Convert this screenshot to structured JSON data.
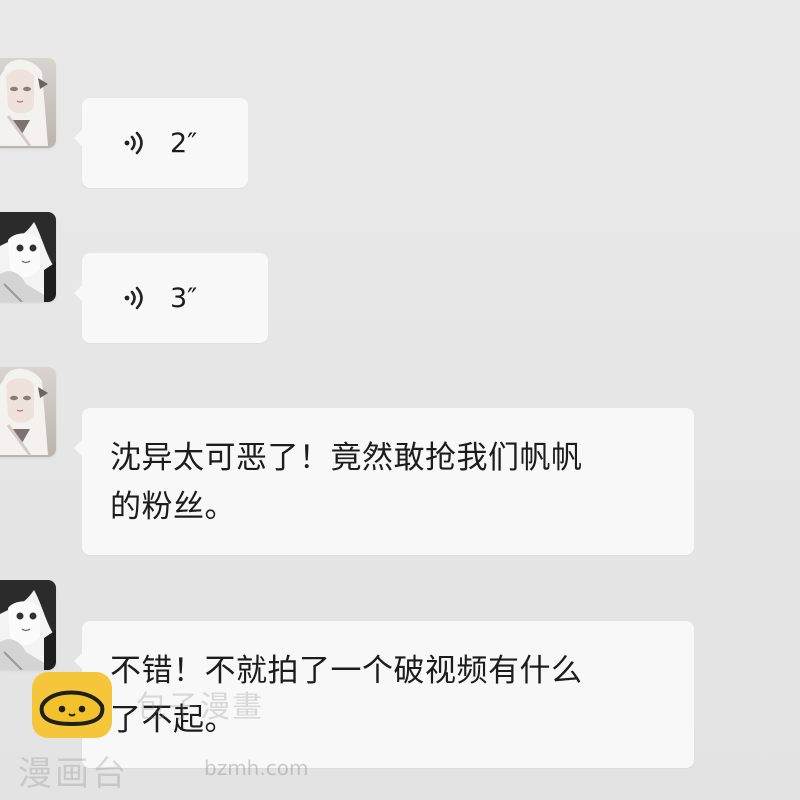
{
  "messages": [
    {
      "type": "voice",
      "avatar": "avatar-girl-silver-hair",
      "duration": "2″"
    },
    {
      "type": "voice",
      "avatar": "avatar-girl-dark-hair",
      "duration": "3″"
    },
    {
      "type": "text",
      "avatar": "avatar-girl-silver-hair",
      "lines": [
        "沈异太可恶了！竟然敢抢我们帆帆",
        "的粉丝。"
      ]
    },
    {
      "type": "text",
      "avatar": "avatar-girl-dark-hair",
      "lines": [
        "不错！不就拍了一个破视频有什么",
        "了不起。"
      ]
    }
  ],
  "watermark": {
    "brand_top": "包子漫畫",
    "brand_bottom": "漫画台",
    "url": "bzmh.com"
  },
  "colors": {
    "background": "#e7e7e7",
    "bubble": "#f8f8f8",
    "text": "#1c1c1c",
    "logo": "#f6c63a"
  }
}
